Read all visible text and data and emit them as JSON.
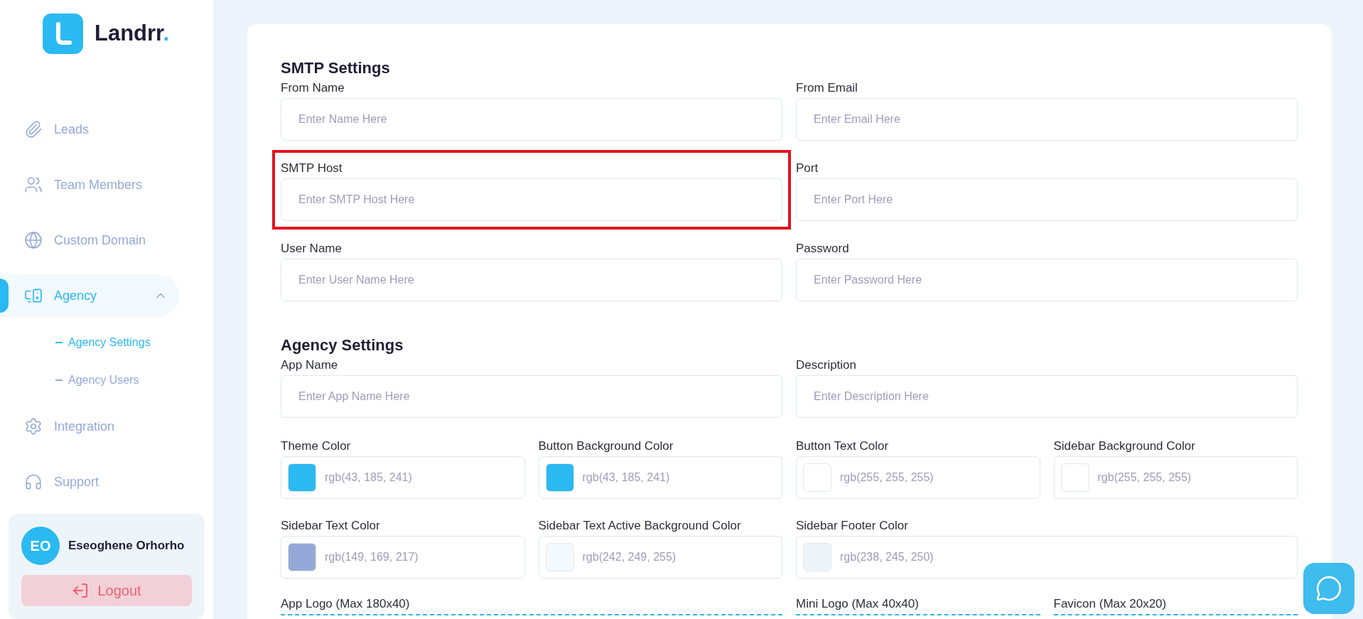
{
  "brand": {
    "name": "Landrr",
    "dot": "."
  },
  "nav": [
    {
      "label": "Leads",
      "selected": false
    },
    {
      "label": "Team Members",
      "selected": false
    },
    {
      "label": "Custom Domain",
      "selected": false
    },
    {
      "label": "Agency",
      "selected": true,
      "expanded": true,
      "children": [
        {
          "label": "Agency Settings",
          "selected": true
        },
        {
          "label": "Agency Users",
          "selected": false
        }
      ]
    },
    {
      "label": "Integration",
      "selected": false
    },
    {
      "label": "Support",
      "selected": false
    }
  ],
  "user": {
    "initials": "EO",
    "name": "Eseoghene Orhorho"
  },
  "logout": "Logout",
  "smtp": {
    "title": "SMTP Settings",
    "fields": [
      {
        "label": "From Name",
        "placeholder": "Enter Name Here",
        "highlighted": false
      },
      {
        "label": "From Email",
        "placeholder": "Enter Email Here",
        "highlighted": false
      },
      {
        "label": "SMTP Host",
        "placeholder": "Enter SMTP Host Here",
        "highlighted": true
      },
      {
        "label": "Port",
        "placeholder": "Enter Port Here",
        "highlighted": false
      },
      {
        "label": "User Name",
        "placeholder": "Enter User Name Here",
        "highlighted": false
      },
      {
        "label": "Password",
        "placeholder": "Enter Password Here",
        "highlighted": false
      }
    ]
  },
  "agency": {
    "title": "Agency Settings",
    "fields": [
      {
        "label": "App Name",
        "placeholder": "Enter App Name Here"
      },
      {
        "label": "Description",
        "placeholder": "Enter Description Here"
      }
    ],
    "colors": [
      {
        "label": "Theme Color",
        "value": "rgb(43, 185, 241)",
        "color": "#2bb9f1"
      },
      {
        "label": "Button Background Color",
        "value": "rgb(43, 185, 241)",
        "color": "#2bb9f1"
      },
      {
        "label": "Button Text Color",
        "value": "rgb(255, 255, 255)",
        "color": "#ffffff"
      },
      {
        "label": "Sidebar Background Color",
        "value": "rgb(255, 255, 255)",
        "color": "#ffffff"
      },
      {
        "label": "Sidebar Text Color",
        "value": "rgb(149, 169, 217)",
        "color": "#95a9d9"
      },
      {
        "label": "Sidebar Text Active Background Color",
        "value": "rgb(242, 249, 255)",
        "color": "#f2f9ff"
      },
      {
        "label": "Sidebar Footer Color",
        "value": "rgb(238, 245, 250)",
        "color": "#eef5fa",
        "wide": true
      }
    ],
    "uploads": [
      {
        "label": "App Logo (Max 180x40)",
        "wide": true
      },
      {
        "label": "Mini Logo (Max 40x40)",
        "wide": false
      },
      {
        "label": "Favicon (Max 20x20)",
        "wide": false
      }
    ]
  }
}
